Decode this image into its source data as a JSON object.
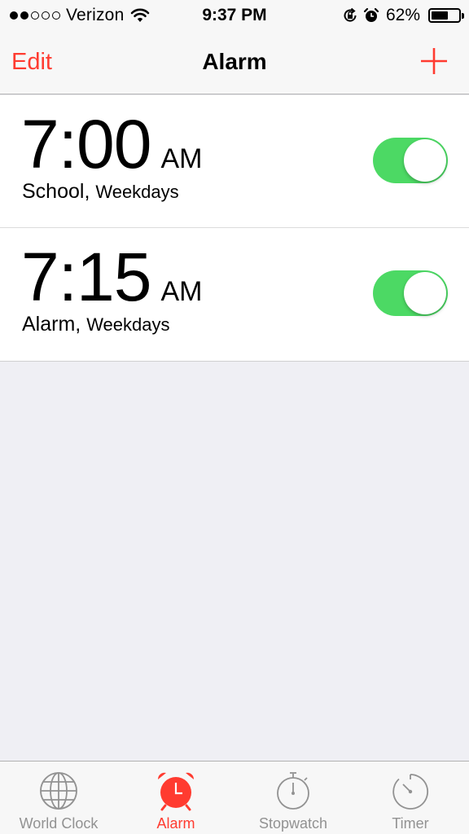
{
  "status_bar": {
    "carrier": "Verizon",
    "signal_bars_filled": 2,
    "signal_bars_total": 5,
    "time": "9:37 PM",
    "battery_percent": "62%",
    "battery_level": 0.62,
    "icons": [
      "wifi-icon",
      "rotation-lock-icon",
      "alarm-clock-icon",
      "battery-icon"
    ]
  },
  "nav": {
    "edit_label": "Edit",
    "title": "Alarm",
    "add_icon": "plus-icon"
  },
  "alarms": [
    {
      "time": "7:00",
      "ampm": "AM",
      "label": "School,",
      "repeat": "Weekdays",
      "enabled": true
    },
    {
      "time": "7:15",
      "ampm": "AM",
      "label": "Alarm,",
      "repeat": "Weekdays",
      "enabled": true
    }
  ],
  "tabs": [
    {
      "label": "World Clock",
      "icon": "globe-icon",
      "active": false
    },
    {
      "label": "Alarm",
      "icon": "alarm-clock-icon",
      "active": true
    },
    {
      "label": "Stopwatch",
      "icon": "stopwatch-icon",
      "active": false
    },
    {
      "label": "Timer",
      "icon": "timer-icon",
      "active": false
    }
  ],
  "colors": {
    "accent": "#ff3b30",
    "toggle_on": "#4cd964",
    "background": "#efeff4",
    "bar_background": "#f7f7f7",
    "inactive_tab": "#929292"
  }
}
